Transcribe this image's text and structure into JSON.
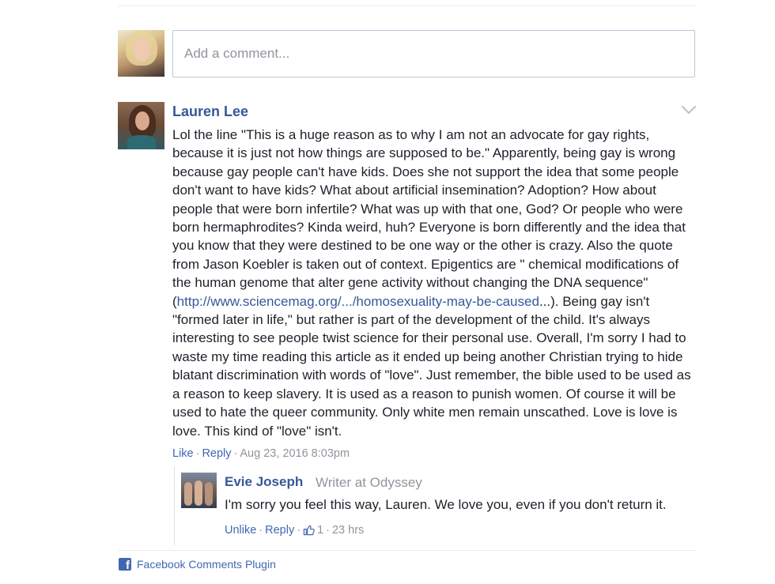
{
  "composer": {
    "placeholder": "Add a comment..."
  },
  "comment": {
    "author": "Lauren Lee",
    "text_before_link": "Lol the line \"This is a huge reason as to why I am not an advocate for gay rights, because it is just not how things are supposed to be.\" Apparently, being gay is wrong because gay people can't have kids. Does she not support the idea that some people don't want to have kids? What about artificial insemination? Adoption? How about people that were born infertile? What was up with that one, God? Or people who were born hermaphrodites? Kinda weird, huh? Everyone is born differently and the idea that you know that they were destined to be one way or the other is crazy. Also the quote from Jason Koebler is taken out of context. Epigentics are \" chemical modifications of the human genome that alter gene activity without changing the DNA sequence\" (",
    "link_text": "http://www.sciencemag.org/.../homosexuality-may-be-caused",
    "text_after_link": "...). Being gay isn't \"formed later in life,\" but rather is part of the development of the child. It's always interesting to see people twist science for their personal use. Overall, I'm sorry I had to waste my time reading this article as it ended up being another Christian trying to hide blatant discrimination with words of \"love\". Just remember, the bible used to be used as a reason to keep slavery. It is used as a reason to punish women. Of course it will be used to hate the queer community. Only white men remain unscathed. Love is love is love. This kind of \"love\" isn't.",
    "like_label": "Like",
    "reply_label": "Reply",
    "timestamp": "Aug 23, 2016 8:03pm"
  },
  "reply": {
    "author": "Evie Joseph",
    "role": "Writer at Odyssey",
    "text": "I'm sorry you feel this way, Lauren. We love you, even if you don't return it.",
    "unlike_label": "Unlike",
    "reply_label": "Reply",
    "like_count": "1",
    "timestamp": "23 hrs"
  },
  "footer": {
    "plugin_label": "Facebook Comments Plugin",
    "icon_letter": "f"
  },
  "icons": {
    "menu": "chevron-down-icon",
    "like": "thumbs-up-icon",
    "brand": "facebook-icon"
  },
  "colors": {
    "link": "#365899",
    "action": "#4267b2",
    "meta": "#90949c",
    "text": "#1d2129"
  }
}
